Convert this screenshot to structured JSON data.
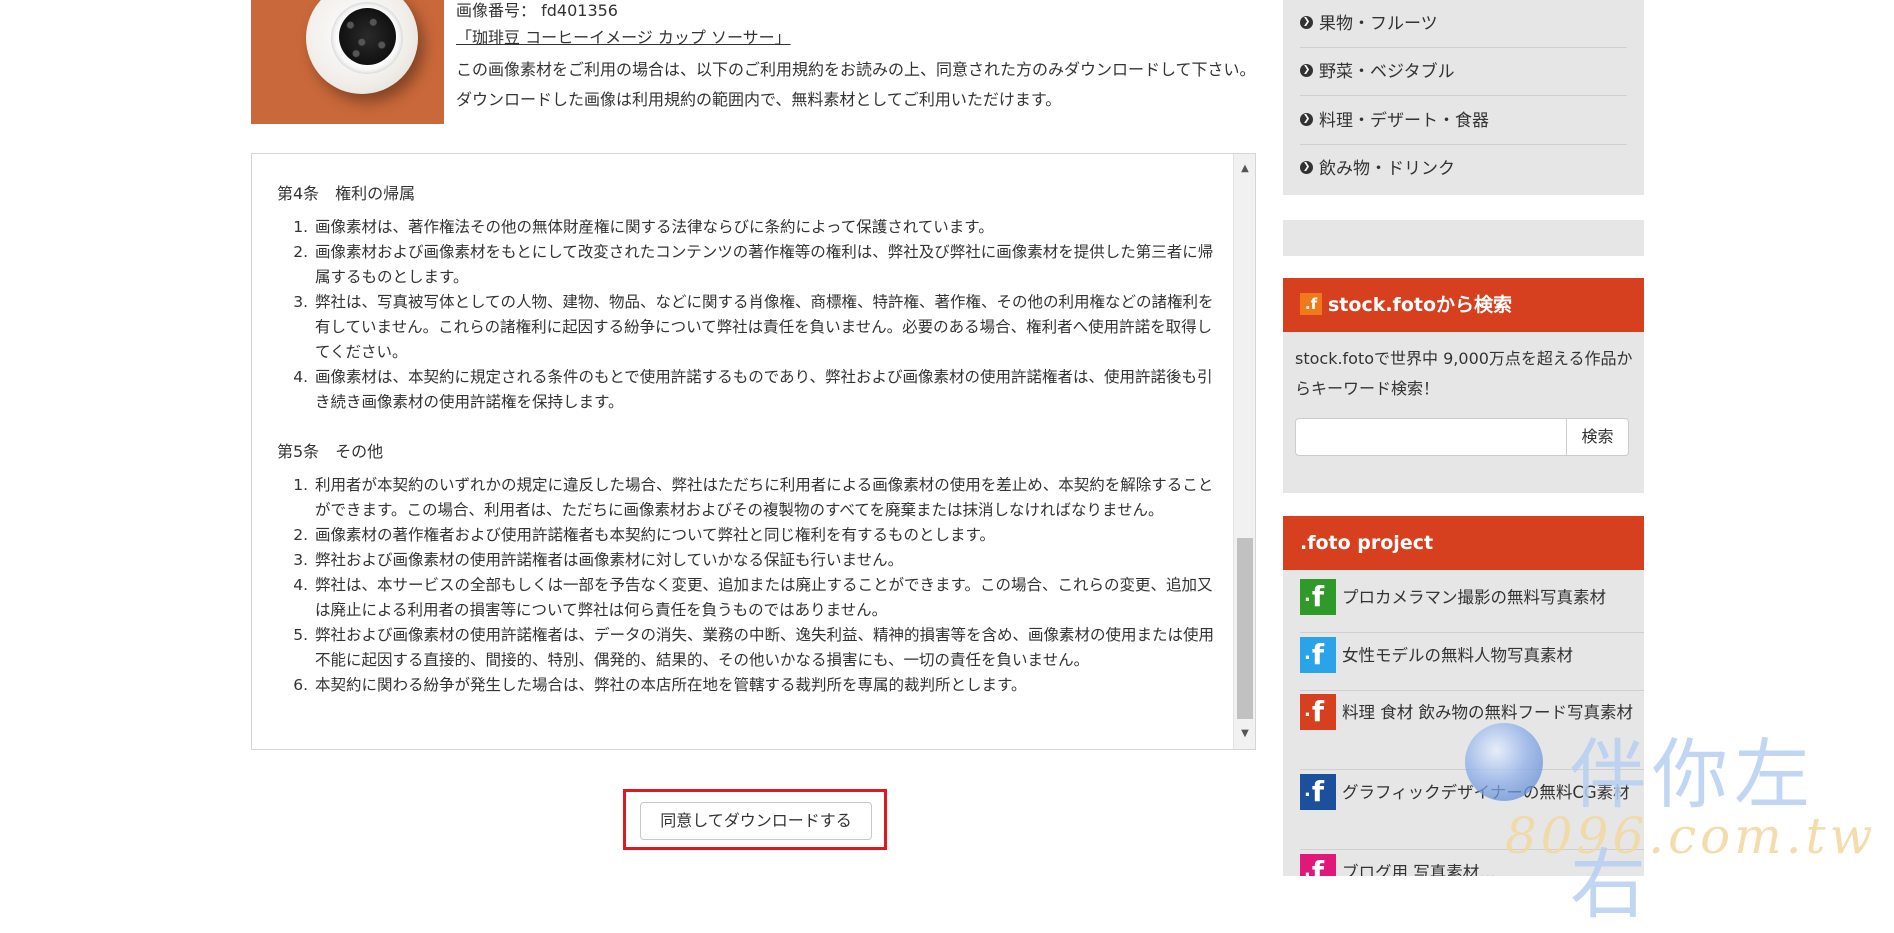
{
  "image": {
    "id_label": "画像番号：",
    "id_value": "fd401356",
    "title": "「珈琲豆 コーヒーイメージ カップ ソーサー」",
    "description": "この画像素材をご利用の場合は、以下のご利用規約をお読みの上、同意された方のみダウンロードして下さい。ダウンロードした画像は利用規約の範囲内で、無料素材としてご利用いただけます。"
  },
  "terms": {
    "section4_title": "第4条　権利の帰属",
    "section4_items": [
      "画像素材は、著作権法その他の無体財産権に関する法律ならびに条約によって保護されています。",
      "画像素材および画像素材をもとにして改変されたコンテンツの著作権等の権利は、弊社及び弊社に画像素材を提供した第三者に帰属するものとします。",
      "弊社は、写真被写体としての人物、建物、物品、などに関する肖像権、商標権、特許権、著作権、その他の利用権などの諸権利を有していません。これらの諸権利に起因する紛争について弊社は責任を負いません。必要のある場合、権利者へ使用許諾を取得してください。",
      "画像素材は、本契約に規定される条件のもとで使用許諾するものであり、弊社および画像素材の使用許諾権者は、使用許諾後も引き続き画像素材の使用許諾権を保持します。"
    ],
    "section5_title": "第5条　その他",
    "section5_items": [
      "利用者が本契約のいずれかの規定に違反した場合、弊社はただちに利用者による画像素材の使用を差止め、本契約を解除することができます。この場合、利用者は、ただちに画像素材およびその複製物のすべてを廃棄または抹消しなければなりません。",
      "画像素材の著作権者および使用許諾権者も本契約について弊社と同じ権利を有するものとします。",
      "弊社および画像素材の使用許諾権者は画像素材に対していかなる保証も行いません。",
      "弊社は、本サービスの全部もしくは一部を予告なく変更、追加または廃止することができます。この場合、これらの変更、追加又は廃止による利用者の損害等について弊社は何ら責任を負うものではありません。",
      "弊社および画像素材の使用許諾権者は、データの消失、業務の中断、逸失利益、精神的損害等を含め、画像素材の使用または使用不能に起因する直接的、間接的、特別、偶発的、結果的、その他いかなる損害にも、一切の責任を負いません。",
      "本契約に関わる紛争が発生した場合は、弊社の本店所在地を管轄する裁判所を専属的裁判所とします。"
    ]
  },
  "download_label": "同意してダウンロードする",
  "sidebar": {
    "categories": [
      "果物・フルーツ",
      "野菜・ベジタブル",
      "料理・デザート・食器",
      "飲み物・ドリンク"
    ],
    "search": {
      "title": "stock.fotoから検索",
      "description": "stock.fotoで世界中 9,000万点を超える作品からキーワード検索！",
      "input_value": "",
      "button_label": "検索"
    },
    "project": {
      "title": ".foto project",
      "items": [
        {
          "label": "プロカメラマン撮影の無料写真素材",
          "color": "#2f9a2a"
        },
        {
          "label": "女性モデルの無料人物写真素材",
          "color": "#2ba3e8"
        },
        {
          "label": "料理 食材 飲み物の無料フード写真素材",
          "color": "#d6401f"
        },
        {
          "label": "グラフィックデザイナーの無料CG素材",
          "color": "#1c4f9c"
        },
        {
          "label": "ブログ用 写真素材…",
          "color": "#e0187a"
        }
      ]
    }
  },
  "watermark": {
    "text": "伴你左右",
    "url": "8096.com.tw"
  },
  "colors": {
    "accent_red": "#d6401f",
    "highlight_border": "#e0171c",
    "sidebar_bg": "#e6e6e6"
  }
}
